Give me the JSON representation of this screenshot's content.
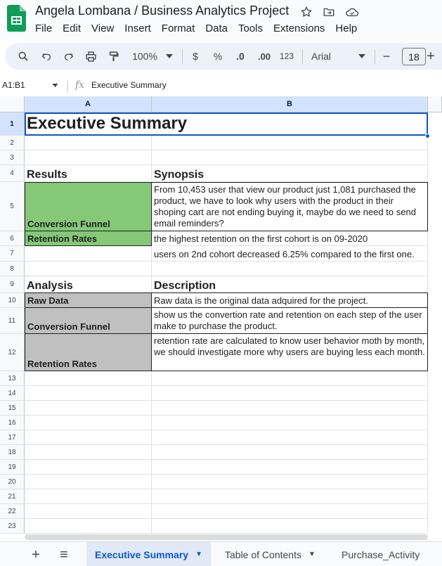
{
  "app": {
    "doc_title": "Angela Lombana / Business Analytics Project",
    "brand_color": "#0f9d58",
    "menu": [
      "File",
      "Edit",
      "View",
      "Insert",
      "Format",
      "Data",
      "Tools",
      "Extensions",
      "Help"
    ]
  },
  "toolbar": {
    "zoom": "100%",
    "currency": "$",
    "percent": "%",
    "dec_less": ".0",
    "dec_more": ".00",
    "number_format": "123",
    "font": "Arial",
    "font_size": "18",
    "minus": "−",
    "plus": "+"
  },
  "formula_bar": {
    "name_box": "A1:B1",
    "fx_label": "fx",
    "content": "Executive Summary"
  },
  "grid": {
    "columns": [
      "A",
      "B"
    ],
    "rows": [
      "1",
      "2",
      "3",
      "4",
      "5",
      "6",
      "7",
      "8",
      "9",
      "10",
      "11",
      "12",
      "13",
      "14",
      "15",
      "16",
      "17",
      "18",
      "19",
      "20",
      "21",
      "22",
      "23"
    ],
    "title": "Executive Summary",
    "results_header": "Results",
    "synopsis_header": "Synopsis",
    "r5_a": "Conversion Funnel",
    "r5_b": "From 10,453 user that view our product just 1,081 purchased the product, we have to look why users with the product in their shoping cart are not ending buying it, maybe do we need to send email reminders?",
    "r6_a": "Retention Rates",
    "r6_b": "the highest retention on the first cohort is on 09-2020",
    "r7_b": "users on 2nd cohort decreased 6.25% compared to the first one.",
    "analysis_header": "Analysis",
    "description_header": "Description",
    "r10_a": "Raw Data",
    "r10_b": "Raw data is the original data adquired for the project.",
    "r11_a": "Conversion Funnel",
    "r11_b": "show us the convertion rate and retention on each step of the user make to purchase the product.",
    "r12_a": "Retention Rates",
    "r12_b": "retention rate are calculated to know user behavior moth by month, we should investigate more why users are buying less each month."
  },
  "sheet_tabs": {
    "add": "+",
    "list": "≡",
    "tabs": [
      "Executive Summary",
      "Table of Contents",
      "Purchase_Activity"
    ]
  }
}
